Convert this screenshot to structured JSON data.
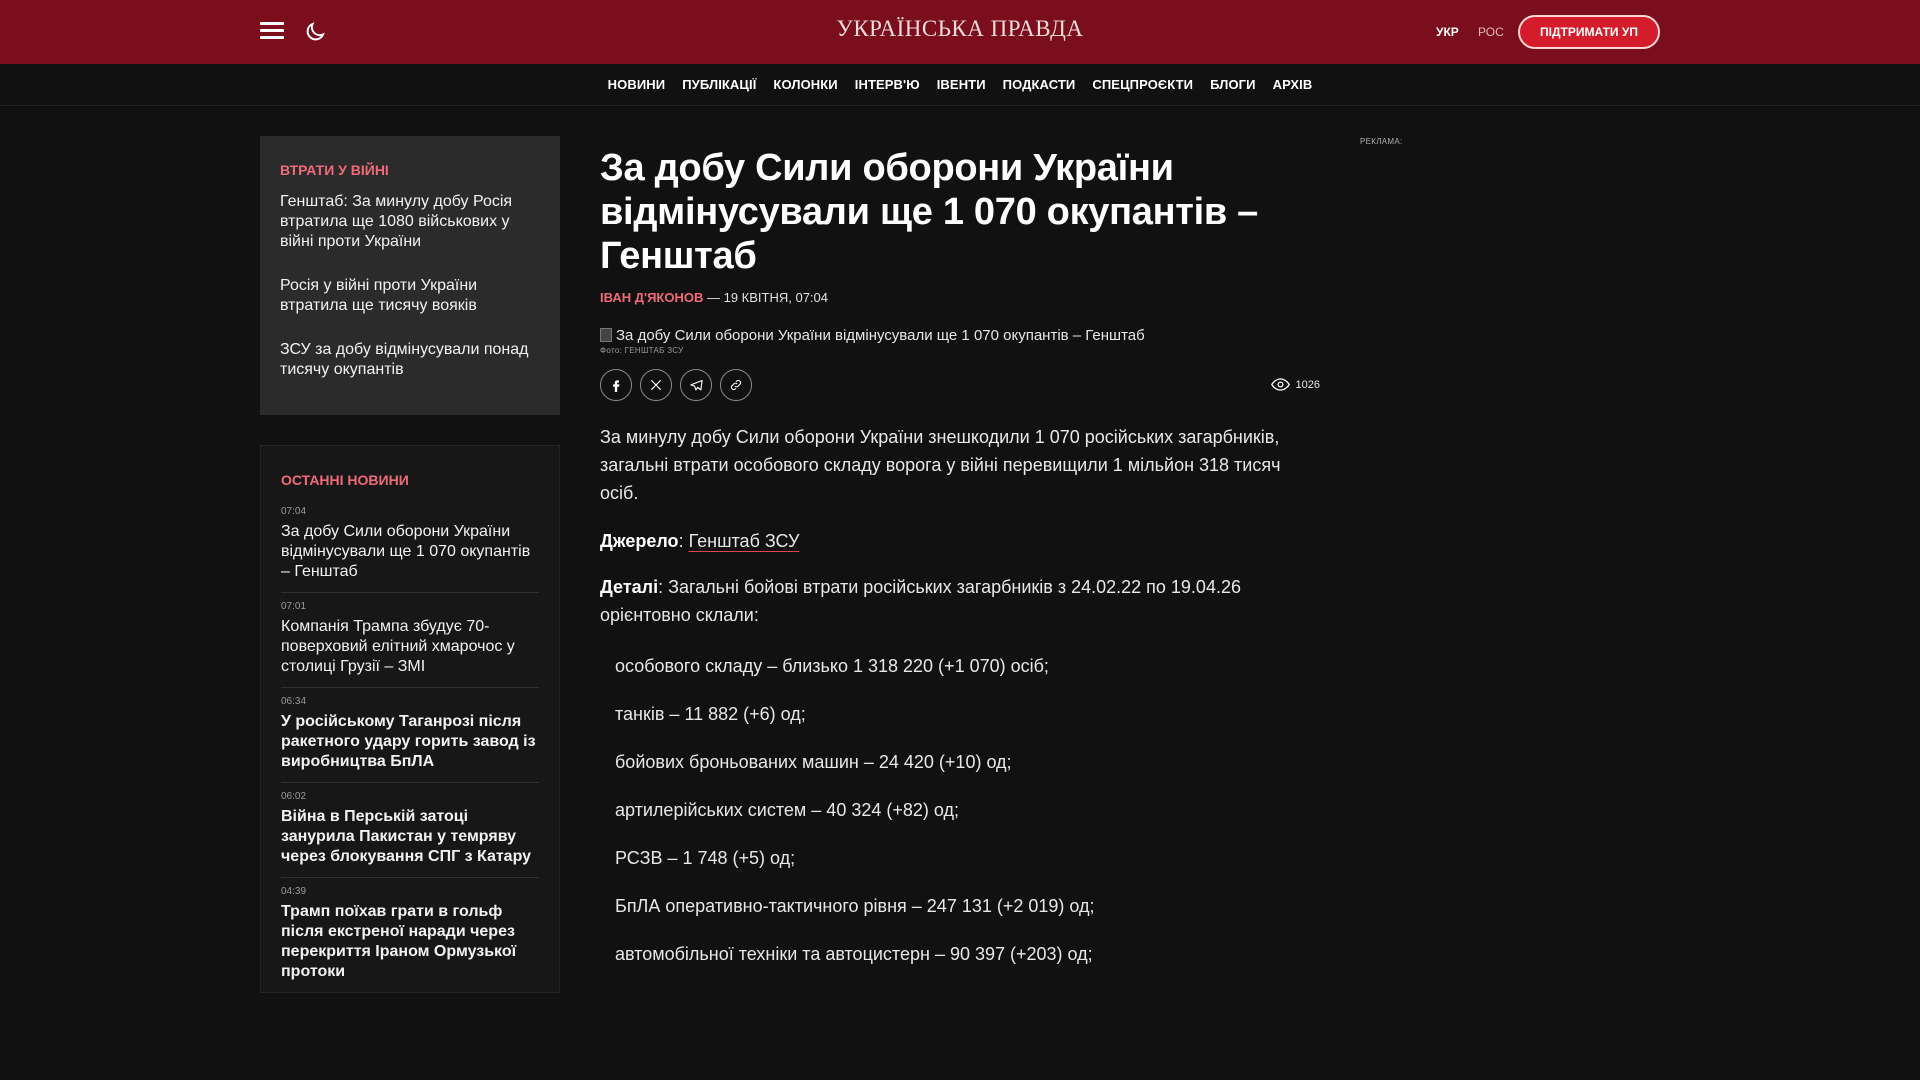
{
  "header": {
    "logo": "УКРАЇНСЬКА ПРАВДА",
    "lang_ukr": "УКР",
    "lang_ros": "РОС",
    "support_label": "ПІДТРИМАТИ УП"
  },
  "nav": {
    "items": [
      "НОВИНИ",
      "ПУБЛІКАЦІЇ",
      "КОЛОНКИ",
      "ІНТЕРВ'Ю",
      "ІВЕНТИ",
      "ПОДКАСТИ",
      "СПЕЦПРОЄКТИ",
      "БЛОГИ",
      "АРХІВ"
    ]
  },
  "war_losses": {
    "heading": "ВТРАТИ У ВІЙНІ",
    "items": [
      "Генштаб: За минулу добу Росія втратила ще 1080 військових у війні проти України",
      "Росія у війні проти України втратила ще тисячу вояків",
      "ЗСУ за добу відмінусували понад тисячу окупантів"
    ]
  },
  "latest_news": {
    "heading": "ОСТАННІ НОВИНИ",
    "items": [
      {
        "time": "07:04",
        "title": "За добу Сили оборони України відмінусували ще 1 070 окупантів – Генштаб"
      },
      {
        "time": "07:01",
        "title": "Компанія Трампа збудує 70-поверховий елітний хмарочос у столиці Грузії – ЗМІ"
      },
      {
        "time": "06:34",
        "title": "У російському Таганрозі після ракетного удару горить завод із виробництва БпЛА"
      },
      {
        "time": "06:02",
        "title": "Війна в Перській затоці занурила Пакистан у темряву через блокування СПГ з Катару"
      },
      {
        "time": "04:39",
        "title": "Трамп поїхав грати в гольф після екстреної наради через перекриття Іраном Ормузької протоки"
      }
    ]
  },
  "article": {
    "title": "За добу Сили оборони України відмінусували ще 1 070 окупантів – Генштаб",
    "author": "ІВАН Д'ЯКОНОВ",
    "date": " — 19 КВІТНЯ, 07:04",
    "photo_alt": "За добу Сили оборони України відмінусували ще 1 070 окупантів – Генштаб",
    "photo_credit": "Фото: ГЕНШТАБ ЗСУ",
    "views": "1026",
    "lead": "За минулу добу Сили оборони України знешкодили 1 070 російських загарбників, загальні втрати особового складу ворога у війні перевищили 1 мільйон 318 тисяч осіб.",
    "source_label": "Джерело",
    "source_sep": ": ",
    "source_link": "Генштаб ЗСУ",
    "details_label": "Деталі",
    "details_text": ": Загальні бойові втрати російських загарбників з 24.02.22 по 19.04.26 орієнтовно склали:",
    "losses": [
      "особового складу – близько 1 318 220 (+1 070) осіб;",
      "танків – 11 882 (+6) од;",
      "бойових броньованих машин – 24 420 (+10) од;",
      "артилерійських систем – 40 324 (+82) од;",
      "РСЗВ – 1 748 (+5) од;",
      "БпЛА оперативно-тактичного рівня – 247 131 (+2 019) од;",
      "автомобільної техніки та автоцистерн – 90 397 (+203) од;"
    ]
  },
  "ad_label": "РЕКЛАМА:"
}
